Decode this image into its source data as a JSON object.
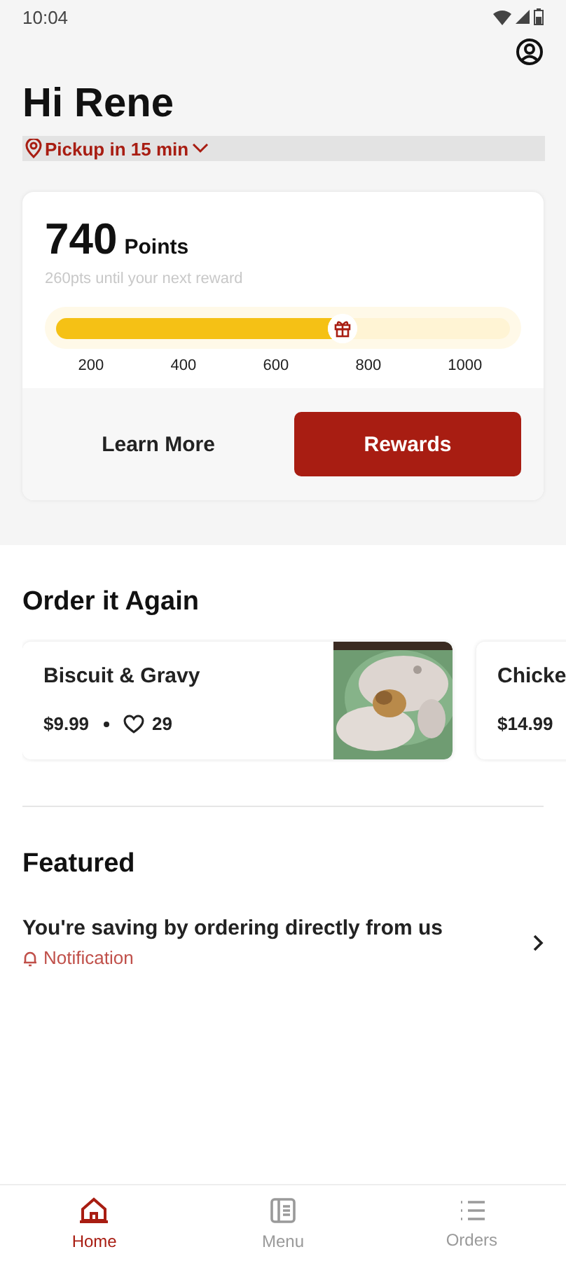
{
  "status_bar": {
    "time": "10:04"
  },
  "greeting": "Hi Rene",
  "pickup": {
    "label": "Pickup in 15 min"
  },
  "rewards": {
    "points": "740",
    "points_label": "Points",
    "subtitle": "260pts until your next reward",
    "level": 0.63,
    "ticks": [
      "200",
      "400",
      "600",
      "800",
      "1000"
    ],
    "buttons": [
      {
        "label": "Learn More",
        "kind": "text"
      },
      {
        "label": "Rewards",
        "kind": "primary"
      }
    ]
  },
  "order_again": {
    "title": "Order it Again",
    "items": [
      {
        "name": "Biscuit & Gravy",
        "price": "$9.99",
        "likes": "29",
        "kind": "picture"
      },
      {
        "name": "Chicke",
        "price": "$14.99"
      }
    ]
  },
  "featured": {
    "title": "Featured",
    "items": [
      {
        "title": "You're saving by ordering directly from us",
        "tag": "Notification"
      }
    ]
  },
  "nav": [
    {
      "label": "Home",
      "kind": "home",
      "selected": true
    },
    {
      "label": "Menu",
      "kind": "menu",
      "selected": false
    },
    {
      "label": "Orders",
      "kind": "orders",
      "selected": false
    }
  ]
}
